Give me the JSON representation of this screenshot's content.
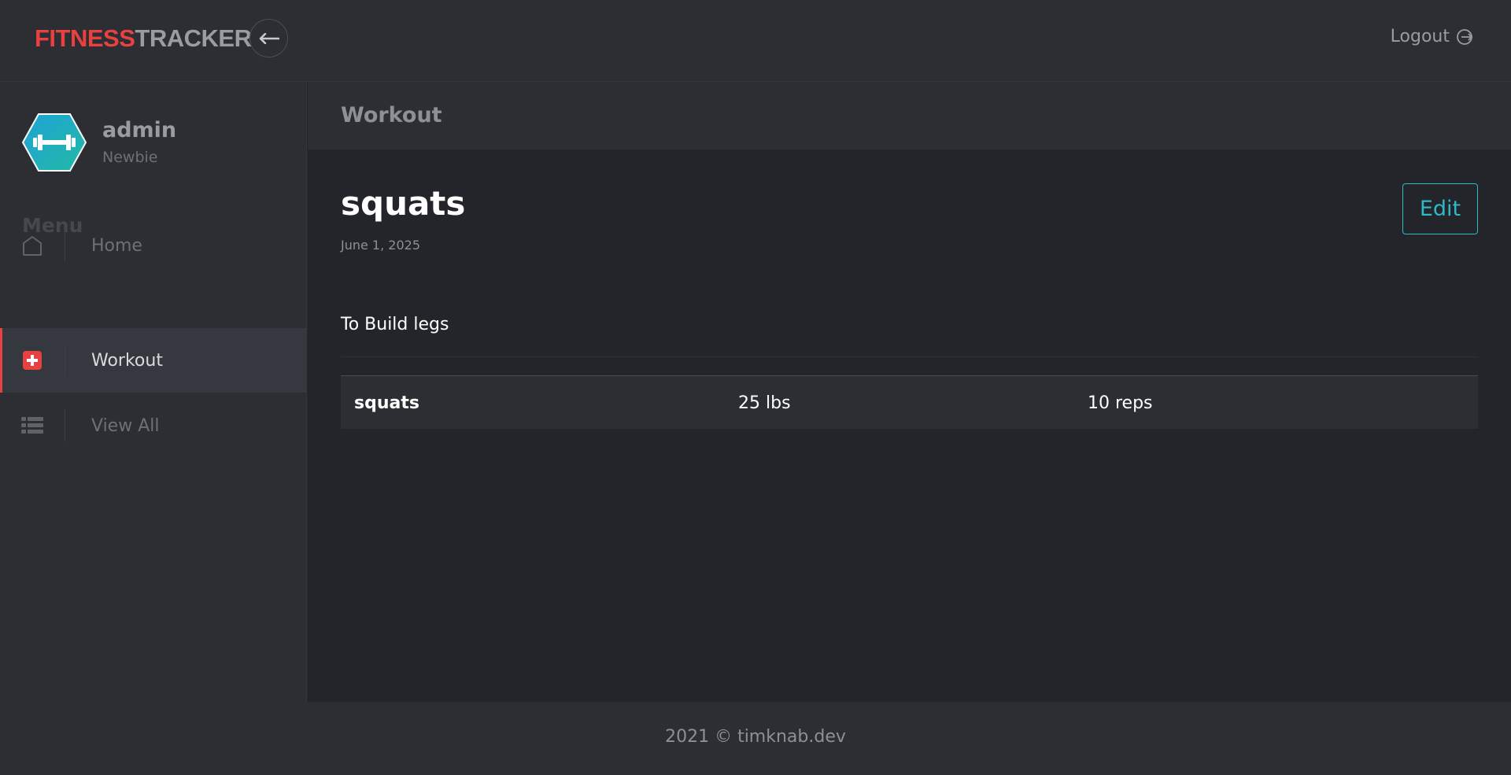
{
  "app": {
    "logo_part1": "FITNESS",
    "logo_part2": "TRACKER",
    "logout_label": "Logout"
  },
  "user": {
    "name": "admin",
    "role": "Newbie"
  },
  "sidebar": {
    "menu_title": "Menu",
    "items": [
      {
        "label": "Home",
        "icon": "home-icon",
        "active": false
      },
      {
        "label": "Workout",
        "icon": "plus-square-icon",
        "active": true
      },
      {
        "label": "View All",
        "icon": "list-icon",
        "active": false
      }
    ]
  },
  "page": {
    "header_title": "Workout"
  },
  "workout": {
    "title": "squats",
    "date": "June 1, 2025",
    "description": "To Build legs",
    "edit_label": "Edit",
    "exercises": [
      {
        "name": "squats",
        "weight": "25 lbs",
        "reps": "10 reps"
      }
    ]
  },
  "footer": {
    "text": "2021 © timknab.dev"
  },
  "colors": {
    "accent_red": "#e8413f",
    "accent_teal": "#2fb8c6",
    "background": "#23252a",
    "panel": "#2c2e33"
  }
}
